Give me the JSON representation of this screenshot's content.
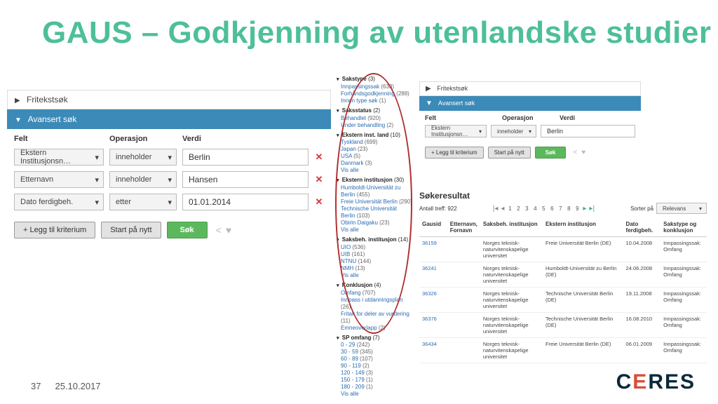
{
  "title": "GAUS – Godkjenning av utenlandske studier",
  "footer": {
    "page": "37",
    "date": "25.10.2017"
  },
  "logo": "CERES",
  "left": {
    "fritekst": "Fritekstsøk",
    "avansert": "Avansert søk",
    "headers": {
      "felt": "Felt",
      "operasjon": "Operasjon",
      "verdi": "Verdi"
    },
    "rows": [
      {
        "felt": "Ekstern Institusjonsn…",
        "op": "inneholder",
        "verdi": "Berlin"
      },
      {
        "felt": "Etternavn",
        "op": "inneholder",
        "verdi": "Hansen"
      },
      {
        "felt": "Dato ferdigbeh.",
        "op": "etter",
        "verdi": "01.01.2014"
      }
    ],
    "buttons": {
      "add": "+ Legg til kriterium",
      "reset": "Start på nytt",
      "search": "Søk"
    }
  },
  "facets": [
    {
      "title": "Sakstype",
      "count": "(3)",
      "items": [
        {
          "label": "Innpassingssak",
          "cnt": "(633)"
        },
        {
          "label": "Forhåndsgodkjenning",
          "cnt": "(288)"
        },
        {
          "label": "Innen type søk",
          "cnt": "(1)"
        }
      ]
    },
    {
      "title": "Saksstatus",
      "count": "(2)",
      "items": [
        {
          "label": "Behandlet",
          "cnt": "(920)"
        },
        {
          "label": "Under behandling",
          "cnt": "(2)"
        }
      ]
    },
    {
      "title": "Ekstern inst. land",
      "count": "(10)",
      "items": [
        {
          "label": "Tyskland",
          "cnt": "(699)"
        },
        {
          "label": "Japan",
          "cnt": "(23)"
        },
        {
          "label": "USA",
          "cnt": "(5)"
        },
        {
          "label": "Danmark",
          "cnt": "(3)"
        }
      ],
      "more": "Vis alle"
    },
    {
      "title": "Ekstern institusjon",
      "count": "(30)",
      "items": [
        {
          "label": "Humboldt-Universität zu Berlin",
          "cnt": "(455)"
        },
        {
          "label": "Freie Universität Berlin",
          "cnt": "(290)"
        },
        {
          "label": "Technische Universität Berlin",
          "cnt": "(103)"
        },
        {
          "label": "Obirin Daigaku",
          "cnt": "(23)"
        }
      ],
      "more": "Vis alle"
    },
    {
      "title": "Saksbeh. institusjon",
      "count": "(14)",
      "items": [
        {
          "label": "UIO",
          "cnt": "(536)"
        },
        {
          "label": "UIB",
          "cnt": "(161)"
        },
        {
          "label": "NTNU",
          "cnt": "(144)"
        },
        {
          "label": "NMH",
          "cnt": "(13)"
        }
      ],
      "more": "Vis alle"
    },
    {
      "title": "Konklusjon",
      "count": "(4)",
      "items": [
        {
          "label": "Omfang",
          "cnt": "(707)"
        },
        {
          "label": "Innpass i utdanningsplan",
          "cnt": "(26)"
        },
        {
          "label": "Fritak for deler av vurdering",
          "cnt": "(11)"
        },
        {
          "label": "Emneoverlapp",
          "cnt": "(2)"
        }
      ]
    },
    {
      "title": "SP omfang",
      "count": "(7)",
      "items": [
        {
          "label": "0 - 29",
          "cnt": "(242)"
        },
        {
          "label": "30 - 59",
          "cnt": "(345)"
        },
        {
          "label": "60 - 89",
          "cnt": "(107)"
        },
        {
          "label": "90 - 119",
          "cnt": "(2)"
        },
        {
          "label": "120 - 149",
          "cnt": "(3)"
        },
        {
          "label": "150 - 179",
          "cnt": "(1)"
        },
        {
          "label": "180 - 209",
          "cnt": "(1)"
        }
      ],
      "more": "Vis alle"
    }
  ],
  "right": {
    "fritekst": "Fritekstsøk",
    "avansert": "Avansert søk",
    "headers": {
      "felt": "Felt",
      "operasjon": "Operasjon",
      "verdi": "Verdi"
    },
    "row": {
      "felt": "Ekstern Institusjonsn…",
      "op": "inneholder",
      "verdi": "Berlin"
    },
    "buttons": {
      "add": "+ Legg til kriterium",
      "reset": "Start på nytt",
      "search": "Søk"
    }
  },
  "results": {
    "title": "Søkeresultat",
    "hits_label": "Antall treff:",
    "hits": "922",
    "sort_label": "Sorter på",
    "sort_value": "Relevans",
    "pages": [
      "1",
      "2",
      "3",
      "4",
      "5",
      "6",
      "7",
      "8",
      "9"
    ],
    "cols": {
      "c1": "Gausid",
      "c2": "Etternavn, Fornavn",
      "c3": "Saksbeh. institusjon",
      "c4": "Ekstern institusjon",
      "c5": "Dato ferdigbeh.",
      "c6": "Sakstype og konklusjon"
    },
    "rows": [
      {
        "id": "36159",
        "inst": "Norges teknisk-naturvitenskapelige universitet",
        "ext": "Freie Universität Berlin (DE)",
        "dato": "10.04.2008",
        "type": "Innpassingssak: Omfang"
      },
      {
        "id": "36241",
        "inst": "Norges teknisk-naturvitenskapelige universitet",
        "ext": "Humboldt-Universität zu Berlin (DE)",
        "dato": "24.06.2008",
        "type": "Innpassingssak: Omfang"
      },
      {
        "id": "36326",
        "inst": "Norges teknisk-naturvitenskapelige universitet",
        "ext": "Technische Universität Berlin (DE)",
        "dato": "19.11.2008",
        "type": "Innpassingssak: Omfang"
      },
      {
        "id": "36376",
        "inst": "Norges teknisk-naturvitenskapelige universitet",
        "ext": "Technische Universität Berlin (DE)",
        "dato": "16.08.2010",
        "type": "Innpassingssak: Omfang"
      },
      {
        "id": "36434",
        "inst": "Norges teknisk-naturvitenskapelige universitet",
        "ext": "Freie Universität Berlin (DE)",
        "dato": "06.01.2009",
        "type": "Innpassingssak: Omfang"
      }
    ]
  }
}
